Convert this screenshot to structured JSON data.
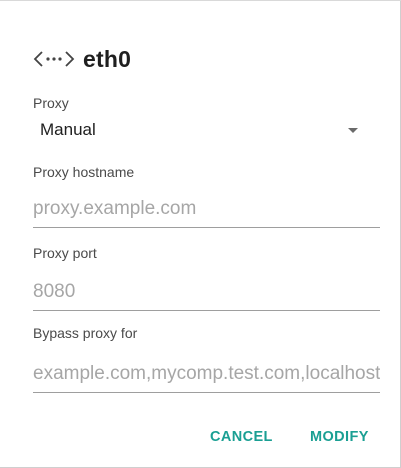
{
  "dialog": {
    "title": "eth0",
    "icon": "ethernet-icon"
  },
  "proxy": {
    "label": "Proxy",
    "selected": "Manual"
  },
  "hostname": {
    "label": "Proxy hostname",
    "value": "",
    "placeholder": "proxy.example.com"
  },
  "port": {
    "label": "Proxy port",
    "value": "",
    "placeholder": "8080"
  },
  "bypass": {
    "label": "Bypass proxy for",
    "value": "",
    "placeholder": "example.com,mycomp.test.com,localhost"
  },
  "actions": {
    "cancel_label": "CANCEL",
    "modify_label": "MODIFY",
    "accent_color": "#1a9f93"
  }
}
